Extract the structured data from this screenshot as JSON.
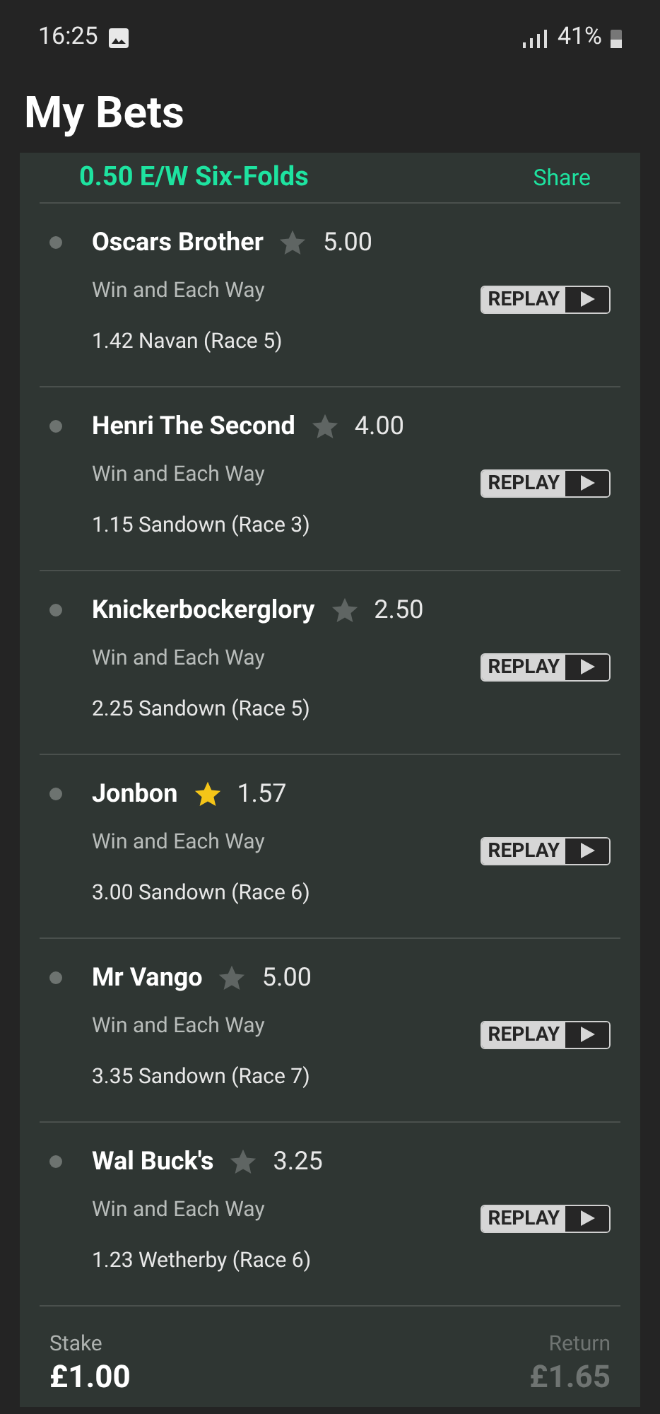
{
  "status_bar": {
    "time": "16:25",
    "battery": "41%"
  },
  "title": "My Bets",
  "bet": {
    "title": "0.50 E/W Six-Folds",
    "share": "Share",
    "legs": [
      {
        "horse": "Oscars Brother",
        "favourite": false,
        "odds": "5.00",
        "market": "Win and Each Way",
        "race": "1.42 Navan (Race 5)",
        "replay": "REPLAY"
      },
      {
        "horse": "Henri The Second",
        "favourite": false,
        "odds": "4.00",
        "market": "Win and Each Way",
        "race": "1.15 Sandown (Race 3)",
        "replay": "REPLAY"
      },
      {
        "horse": "Knickerbockerglory",
        "favourite": false,
        "odds": "2.50",
        "market": "Win and Each Way",
        "race": "2.25 Sandown (Race 5)",
        "replay": "REPLAY"
      },
      {
        "horse": "Jonbon",
        "favourite": true,
        "odds": "1.57",
        "market": "Win and Each Way",
        "race": "3.00 Sandown (Race 6)",
        "replay": "REPLAY"
      },
      {
        "horse": "Mr Vango",
        "favourite": false,
        "odds": "5.00",
        "market": "Win and Each Way",
        "race": "3.35 Sandown (Race 7)",
        "replay": "REPLAY"
      },
      {
        "horse": "Wal Buck's",
        "favourite": false,
        "odds": "3.25",
        "market": "Win and Each Way",
        "race": "1.23 Wetherby (Race 6)",
        "replay": "REPLAY"
      }
    ],
    "stake_label": "Stake",
    "stake": "£1.00",
    "return_label": "Return",
    "return": "£1.65"
  }
}
